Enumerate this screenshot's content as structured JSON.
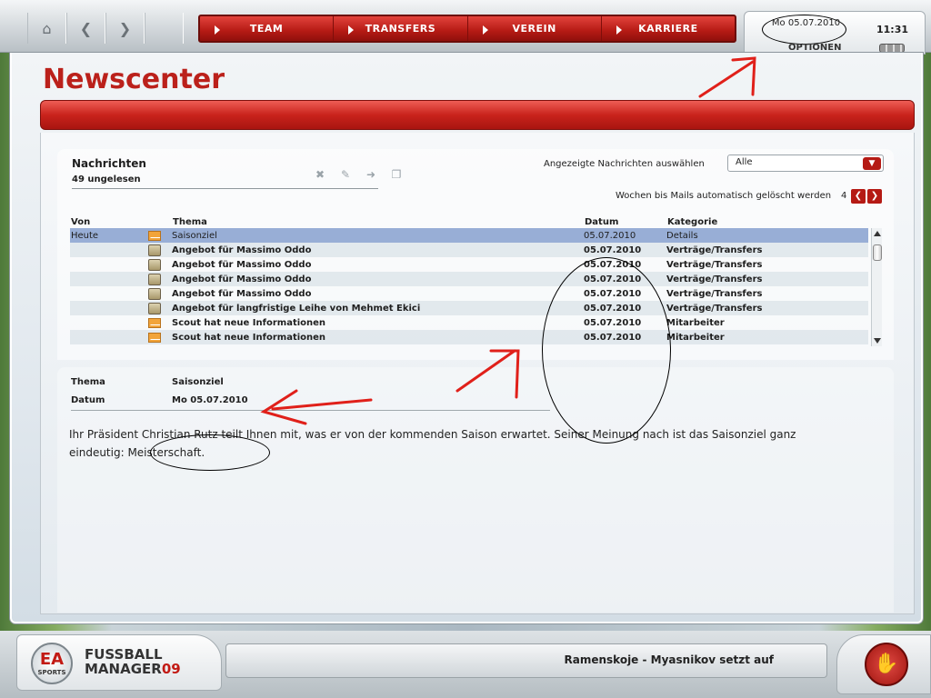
{
  "nav": {
    "home_icon": "home-icon",
    "back_icon": "back-arrow-icon",
    "forward_icon": "forward-arrow-icon",
    "items": [
      {
        "label": "TEAM"
      },
      {
        "label": "TRANSFERS"
      },
      {
        "label": "VEREIN"
      },
      {
        "label": "KARRIERE"
      }
    ]
  },
  "clock": {
    "date": "Mo 05.07.2010",
    "time": "11:31",
    "options": "OPTIONEN"
  },
  "page": {
    "title": "Newscenter"
  },
  "messages": {
    "title": "Nachrichten",
    "unread": "49 ungelesen",
    "filter_label": "Angezeigte Nachrichten auswählen",
    "filter_value": "Alle",
    "weeks_label": "Wochen bis Mails automatisch gelöscht werden",
    "weeks_value": "4",
    "columns": {
      "from": "Von",
      "subject": "Thema",
      "date": "Datum",
      "category": "Kategorie"
    },
    "rows": [
      {
        "from": "Heute",
        "icon": "mail",
        "subject": "Saisonziel",
        "date": "05.07.2010",
        "category": "Details"
      },
      {
        "from": "",
        "icon": "offer",
        "subject": "Angebot für Massimo Oddo",
        "date": "05.07.2010",
        "category": "Verträge/Transfers"
      },
      {
        "from": "",
        "icon": "offer",
        "subject": "Angebot für Massimo Oddo",
        "date": "05.07.2010",
        "category": "Verträge/Transfers"
      },
      {
        "from": "",
        "icon": "offer",
        "subject": "Angebot für Massimo Oddo",
        "date": "05.07.2010",
        "category": "Verträge/Transfers"
      },
      {
        "from": "",
        "icon": "offer",
        "subject": "Angebot für Massimo Oddo",
        "date": "05.07.2010",
        "category": "Verträge/Transfers"
      },
      {
        "from": "",
        "icon": "offer",
        "subject": "Angebot für langfristige Leihe von Mehmet Ekici",
        "date": "05.07.2010",
        "category": "Verträge/Transfers"
      },
      {
        "from": "",
        "icon": "mail",
        "subject": "Scout hat neue Informationen",
        "date": "05.07.2010",
        "category": "Mitarbeiter"
      },
      {
        "from": "",
        "icon": "mail",
        "subject": "Scout hat neue Informationen",
        "date": "05.07.2010",
        "category": "Mitarbeiter"
      }
    ]
  },
  "detail": {
    "subject_label": "Thema",
    "subject_value": "Saisonziel",
    "date_label": "Datum",
    "date_value": "Mo 05.07.2010",
    "body": "Ihr Präsident Christian Rutz teilt Ihnen mit, was er von der kommenden Saison erwartet. Seiner Meinung nach ist das Saisonziel ganz eindeutig: Meisterschaft."
  },
  "footer": {
    "logo_ea": "EA",
    "logo_sports": "SPORTS",
    "logo_line1": "FUSSBALL",
    "logo_line2": "MANAGER",
    "logo_num": "09",
    "ticker": "Ramenskoje - Myasnikov setzt auf"
  },
  "colors": {
    "accent_red": "#b51a14",
    "selected_row": "#98aed6",
    "annotation_red": "#e0201a"
  }
}
